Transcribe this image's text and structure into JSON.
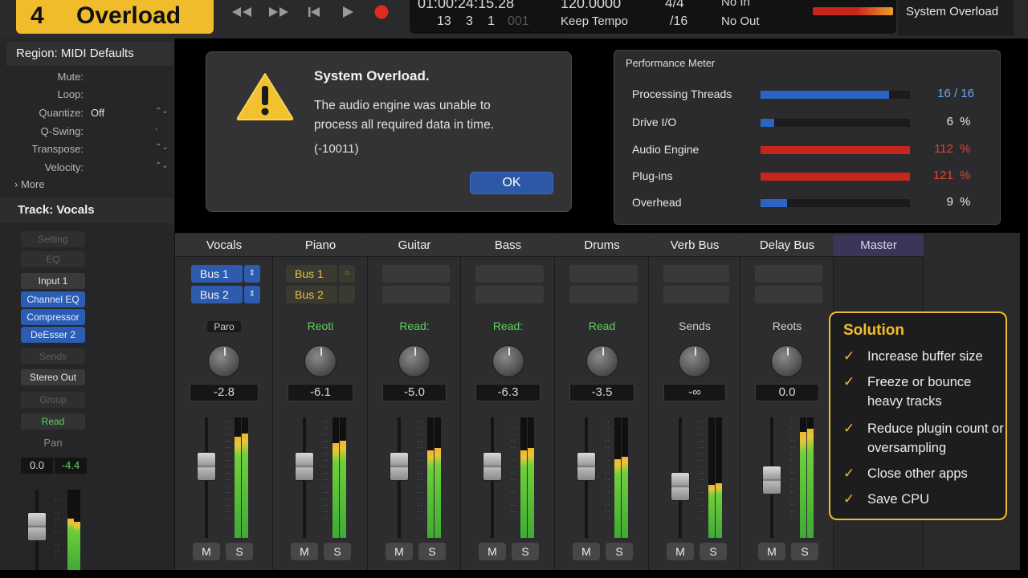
{
  "window": {
    "title_number": "4",
    "title_text": "Overload",
    "overload_indicator_label": "System Overload"
  },
  "lcd": {
    "position": "01:00:24:15.28",
    "bars_beats": [
      "13",
      "3",
      "1",
      "001"
    ],
    "tempo": "120.0000",
    "tempo_mode": "Keep Tempo",
    "signature_top": "4/4",
    "signature_bottom": "/16",
    "midi_in": "No In",
    "midi_out": "No Out"
  },
  "colors": {
    "accent": "#f0bc2b",
    "blue": "#2c58a6",
    "red": "#c8261d",
    "green": "#5ed35a"
  },
  "inspector": {
    "region_title": "Region: MIDI Defaults",
    "params": [
      {
        "label": "Mute:",
        "value": ""
      },
      {
        "label": "Loop:",
        "value": ""
      },
      {
        "label": "Quantize:",
        "value": "Off"
      },
      {
        "label": "Q-Swing:",
        "value": ""
      },
      {
        "label": "Transpose:",
        "value": ""
      },
      {
        "label": "Velocity:",
        "value": ""
      }
    ],
    "more_label": "More",
    "track_title": "Track:  Vocals",
    "slots": {
      "setting": "Setting",
      "eq": "EQ",
      "input": "Input 1",
      "plugin1": "Channel EQ",
      "plugin2": "Compressor",
      "plugin3": "DeEsser 2",
      "sends": "Sends",
      "output": "Stereo Out",
      "group": "Group",
      "automation": "Read",
      "pan": "Pan",
      "volume": "0.0",
      "pan_value": "-4.4"
    }
  },
  "dialog": {
    "title": "System Overload.",
    "message_line1": "The audio engine was unable to",
    "message_line2": "process all required data in time.",
    "error_code": "(-10011)",
    "ok_label": "OK"
  },
  "performance": {
    "title": "Performance Meter",
    "rows": [
      {
        "label": "Processing Threads",
        "value": "16 / 16",
        "unit": "",
        "fill": 0.86,
        "color": "#2c64c4",
        "value_color": "#6fa4f0"
      },
      {
        "label": "Drive I/O",
        "value": "6",
        "unit": "%",
        "fill": 0.09,
        "color": "#2c64c4",
        "value_color": "#e8e8e8"
      },
      {
        "label": "Audio Engine",
        "value": "112",
        "unit": "%",
        "fill": 1.0,
        "color": "#c8261d",
        "value_color": "#e8402f"
      },
      {
        "label": "Plug-ins",
        "value": "121",
        "unit": "%",
        "fill": 1.0,
        "color": "#c8261d",
        "value_color": "#e8402f"
      },
      {
        "label": "Overhead",
        "value": "9",
        "unit": "%",
        "fill": 0.18,
        "color": "#2c64c4",
        "value_color": "#e8e8e8"
      }
    ]
  },
  "mixer": {
    "channels": [
      {
        "name": "Vocals",
        "send1": "Bus 1",
        "send2": "Bus 2",
        "send_style": "blue",
        "automation": "Paro",
        "auto_color": "#cfcfcf",
        "volume": "-2.8",
        "meter": 0.88,
        "fader": 0.62
      },
      {
        "name": "Piano",
        "send1": "Bus 1",
        "send2": "Bus 2",
        "send_style": "gold",
        "automation": "Reoti",
        "auto_color": "#5ed35a",
        "volume": "-6.1",
        "meter": 0.82,
        "fader": 0.62
      },
      {
        "name": "Guitar",
        "send1": "",
        "send2": "",
        "send_style": "empty",
        "automation": "Read:",
        "auto_color": "#5ed35a",
        "volume": "-5.0",
        "meter": 0.76,
        "fader": 0.62
      },
      {
        "name": "Bass",
        "send1": "",
        "send2": "",
        "send_style": "empty",
        "automation": "Read:",
        "auto_color": "#5ed35a",
        "volume": "-6.3",
        "meter": 0.76,
        "fader": 0.62
      },
      {
        "name": "Drums",
        "send1": "",
        "send2": "",
        "send_style": "empty",
        "automation": "Read",
        "auto_color": "#5ed35a",
        "volume": "-3.5",
        "meter": 0.68,
        "fader": 0.62
      },
      {
        "name": "Verb Bus",
        "send1": "",
        "send2": "",
        "send_style": "empty",
        "automation": "Sends",
        "auto_color": "#cfcfcf",
        "volume": "-∞",
        "meter": 0.46,
        "fader": 0.4
      },
      {
        "name": "Delay Bus",
        "send1": "",
        "send2": "",
        "send_style": "empty",
        "automation": "Reots",
        "auto_color": "#cfcfcf",
        "volume": "0.0",
        "meter": 0.92,
        "fader": 0.47
      },
      {
        "name": "Master",
        "send1": "",
        "send2": "",
        "send_style": "none",
        "automation": "",
        "auto_color": "#cfcfcf",
        "volume": "",
        "meter": 0,
        "fader": 0
      }
    ],
    "mute_label": "M",
    "solo_label": "S"
  },
  "solution": {
    "title": "Solution",
    "items": [
      "Increase buffer size",
      "Freeze or bounce heavy tracks",
      "Reduce plugin count or oversampling",
      "Close other apps",
      "Save CPU"
    ]
  }
}
